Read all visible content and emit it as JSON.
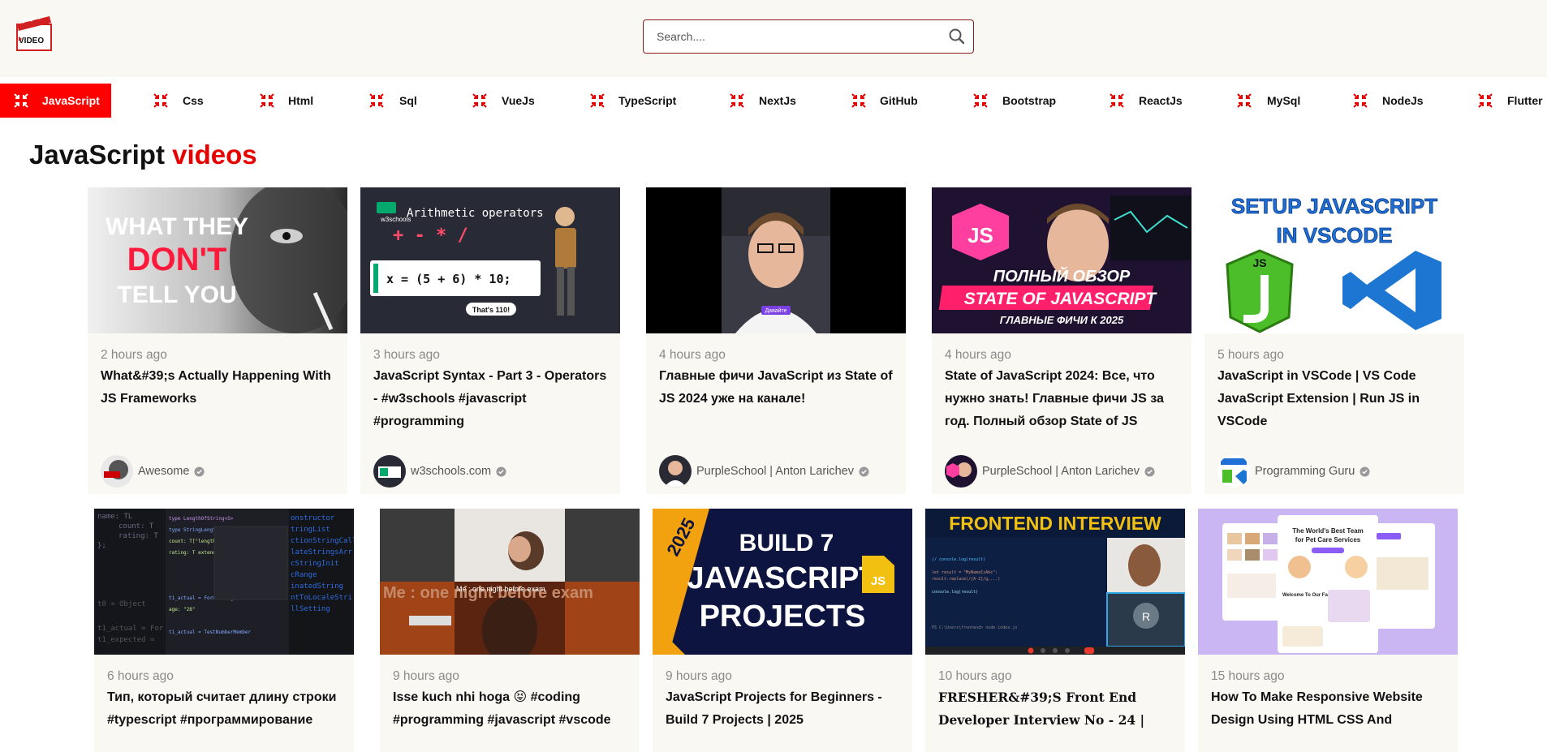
{
  "search": {
    "placeholder": "Search...."
  },
  "logo": {
    "text": "VIDEO"
  },
  "nav": {
    "items": [
      {
        "label": "JavaScript",
        "active": true
      },
      {
        "label": "Css"
      },
      {
        "label": "Html"
      },
      {
        "label": "Sql"
      },
      {
        "label": "VueJs"
      },
      {
        "label": "TypeScript"
      },
      {
        "label": "NextJs"
      },
      {
        "label": "GitHub"
      },
      {
        "label": "Bootstrap"
      },
      {
        "label": "ReactJs"
      },
      {
        "label": "MySql"
      },
      {
        "label": "NodeJs"
      },
      {
        "label": "Flutter"
      }
    ]
  },
  "section": {
    "title_main": "JavaScript",
    "title_accent": "videos"
  },
  "videos": [
    {
      "time": "2 hours ago",
      "title": "What&#39;s Actually Happening With JS Frameworks",
      "channel": "Awesome",
      "thumb_text": [
        "WHAT THEY",
        "DON'T",
        "TELL YOU"
      ]
    },
    {
      "time": "3 hours ago",
      "title": "JavaScript Syntax - Part 3 - Operators - #w3schools #javascript #programming",
      "channel": "w3schools.com",
      "thumb_text": [
        "Arithmetic operators",
        "x = (5 + 6) * 10;",
        "That's 110!",
        "w3schools"
      ]
    },
    {
      "time": "4 hours ago",
      "title": "Главные фичи JavaScript из State of JS 2024 уже на канале!",
      "channel": "PurpleSchool | Anton Larichev",
      "thumb_text": [
        "Давайте"
      ]
    },
    {
      "time": "4 hours ago",
      "title": "State of JavaScript 2024: Все, что нужно знать! Главные фичи JS за год. Полный обзор State of JS",
      "channel": "PurpleSchool | Anton Larichev",
      "thumb_text": [
        "ПОЛНЫЙ ОБЗОР",
        "STATE OF JAVASCRIPT",
        "ГЛАВНЫЕ ФИЧИ К 2025"
      ]
    },
    {
      "time": "5 hours ago",
      "title": "JavaScript in VSCode | VS Code JavaScript Extension | Run JS in VSCode",
      "channel": "Programming Guru",
      "thumb_text": [
        "SETUP JAVASCRIPT",
        "IN VSCODE",
        "JS"
      ]
    },
    {
      "time": "6 hours ago",
      "title": "Тип, который считает длину строки #typescript #программирование"
    },
    {
      "time": "9 hours ago",
      "title": "Isse kuch nhi hoga 😝 #coding #programming #javascript #vscode",
      "thumb_text": [
        "Me : one night before exam",
        "Me : one night before exam"
      ]
    },
    {
      "time": "9 hours ago",
      "title": "JavaScript Projects for Beginners - Build 7 Projects | 2025",
      "thumb_text": [
        "2025",
        "BUILD 7",
        "JAVASCRIPT",
        "PROJECTS",
        "JS"
      ]
    },
    {
      "time": "10 hours ago",
      "title": "FRESHER&#39;S Front End Developer Interview No - 24 |",
      "thumb_text": [
        "FRONTEND INTERVIEW",
        "R"
      ]
    },
    {
      "time": "15 hours ago",
      "title": "How To Make Responsive Website Design Using HTML CSS And",
      "thumb_text": [
        "The World's Best Team",
        "for Pet Care Services",
        "Welcome To Our Family"
      ]
    }
  ],
  "colors": {
    "accent": "#ff0000",
    "card_bg": "#faf8f3",
    "border": "#8b1a1a"
  }
}
